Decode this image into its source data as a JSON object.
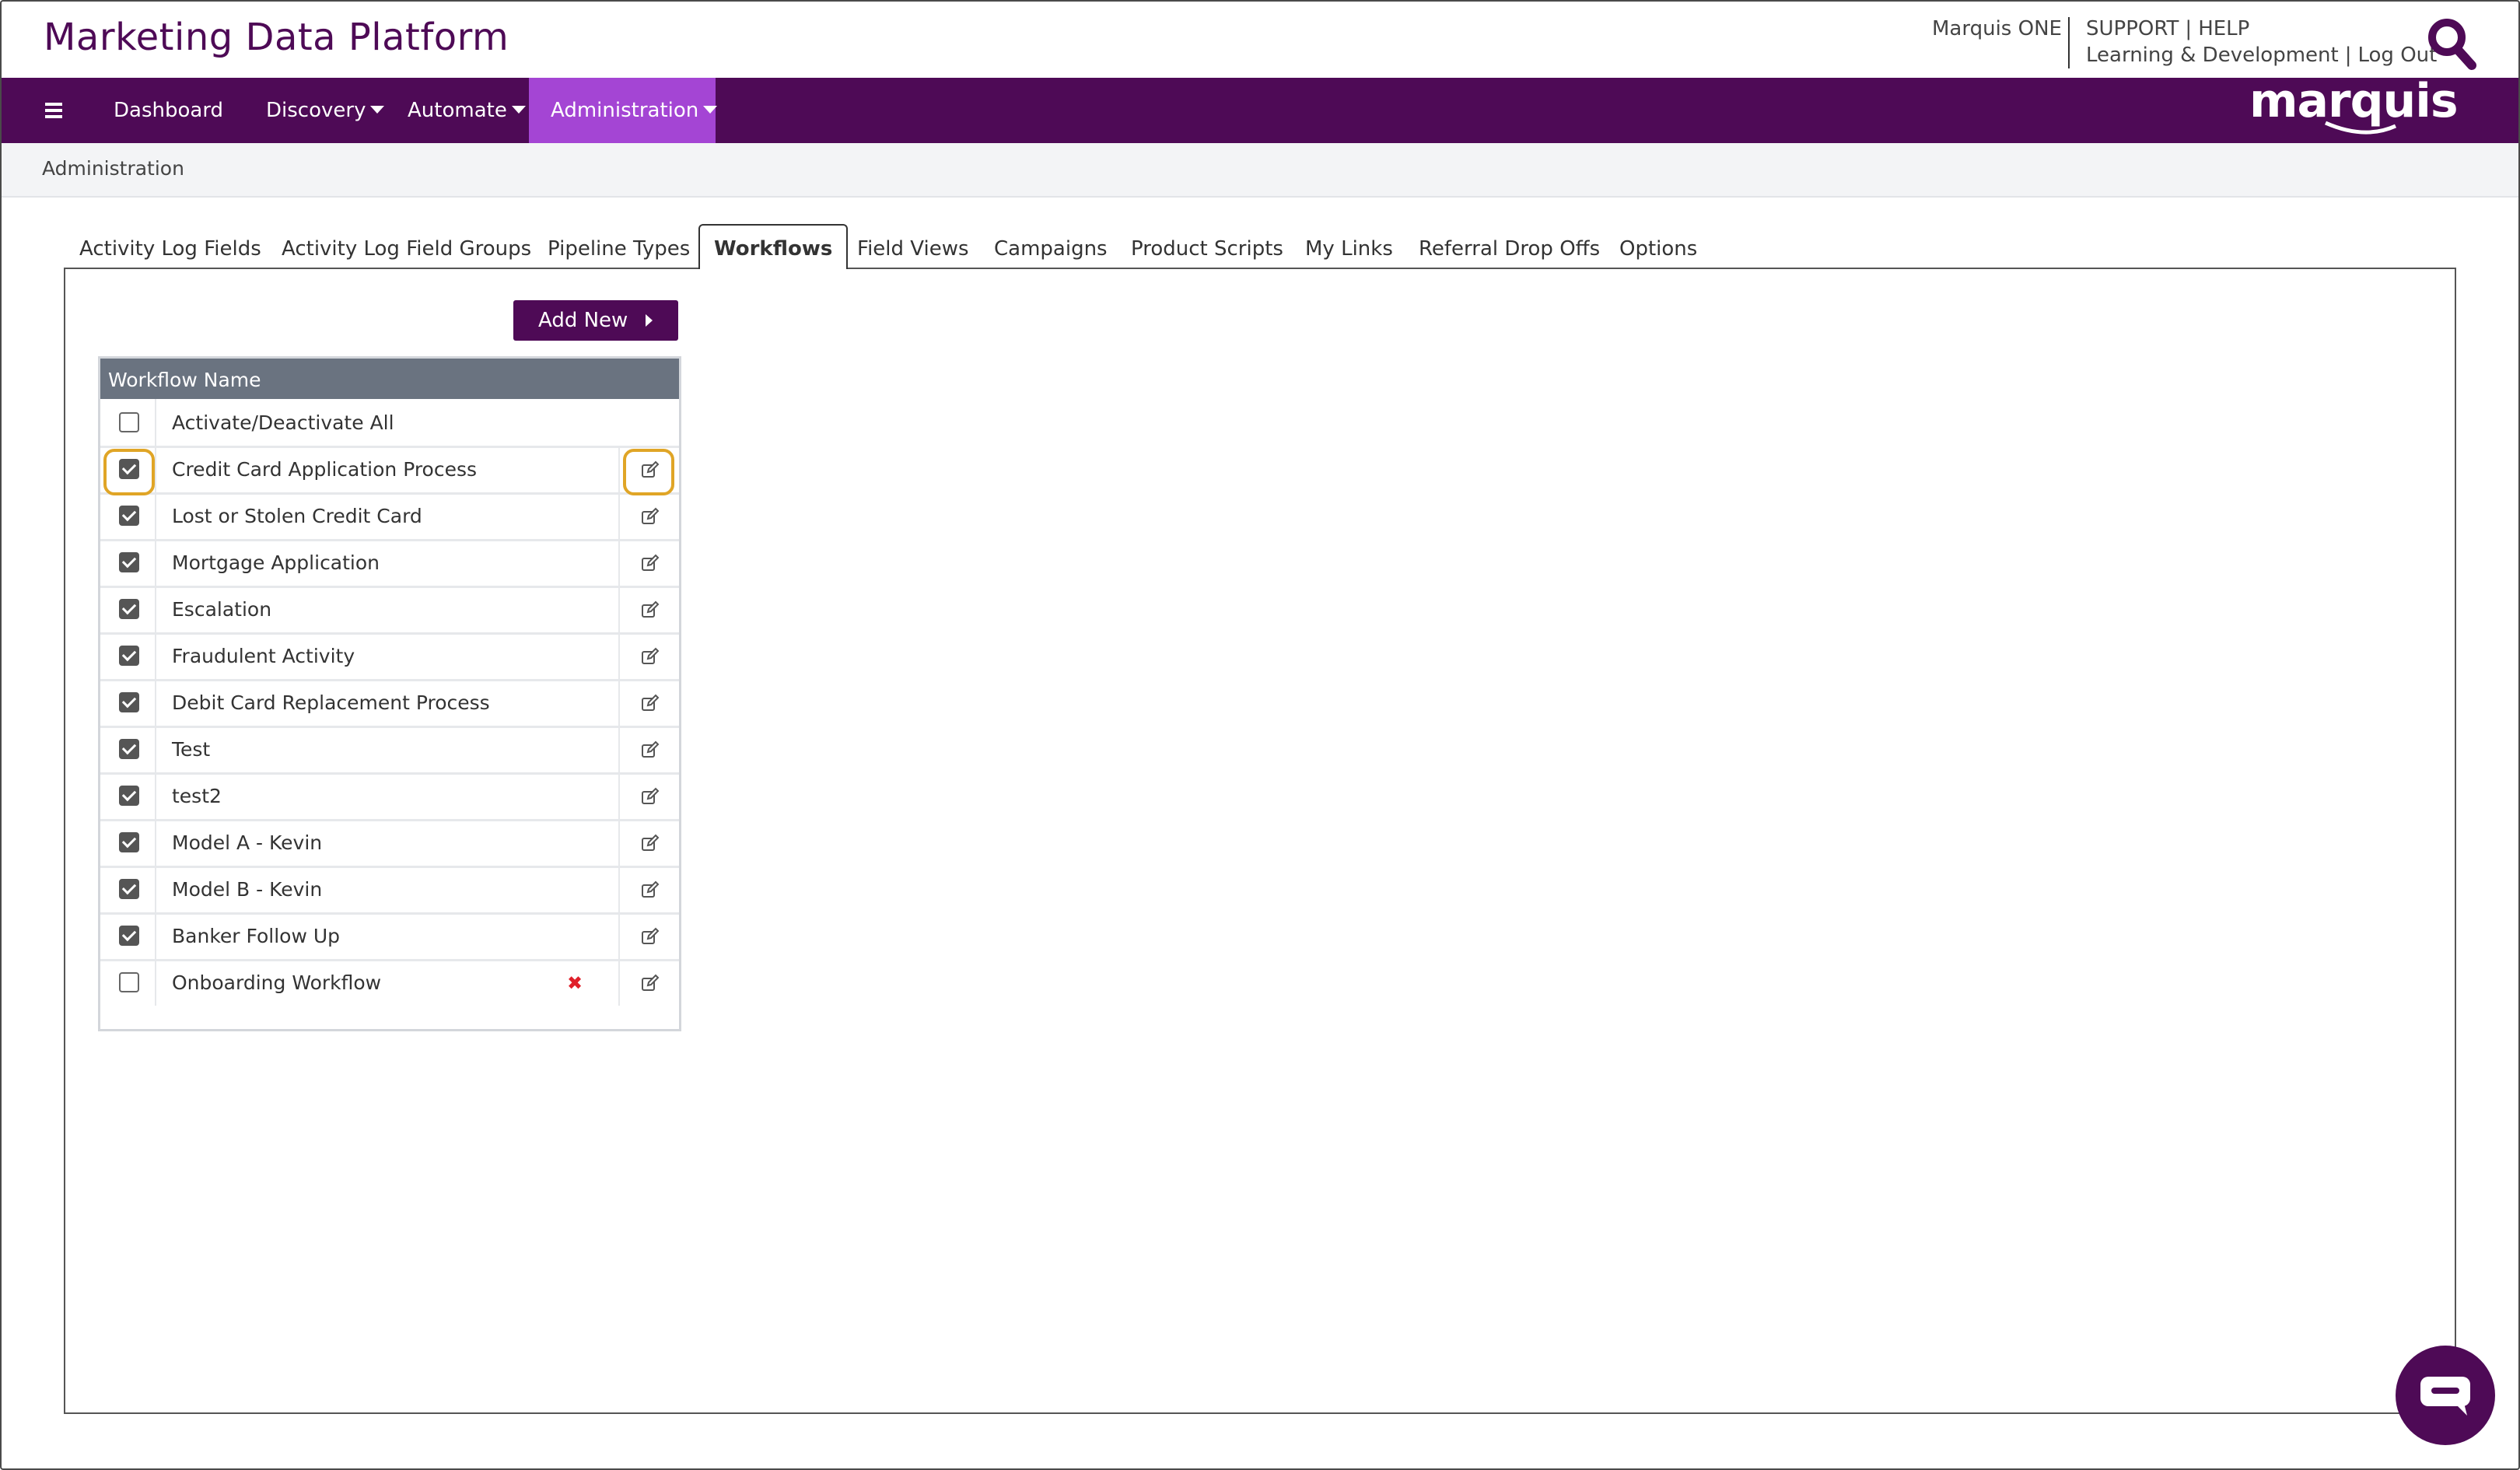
{
  "header": {
    "app_title": "Marketing Data Platform",
    "marquis_one": "Marquis ONE",
    "support": "SUPPORT",
    "help": "HELP",
    "learning": "Learning & Development",
    "logout": "Log Out",
    "search_icon": "search-icon"
  },
  "nav": {
    "menu_icon": "hamburger-menu-icon",
    "items": [
      "Dashboard",
      "Discovery",
      "Automate",
      "Administration"
    ],
    "active": "Administration",
    "logo_text": "marquis",
    "colors": {
      "bar": "#4e0a56",
      "active": "#a445d4"
    }
  },
  "breadcrumb": "Administration",
  "tabs": {
    "items": [
      "Activity Log Fields",
      "Activity Log Field Groups",
      "Pipeline Types",
      "Workflows",
      "Field Views",
      "Campaigns",
      "Product Scripts",
      "My Links",
      "Referral Drop Offs",
      "Options"
    ],
    "active": "Workflows"
  },
  "add_new_label": "Add New",
  "table": {
    "header": "Workflow Name",
    "select_all": {
      "label": "Activate/Deactivate All",
      "checked": false
    },
    "rows": [
      {
        "name": "Credit Card Application Process",
        "checked": true,
        "deletable": false,
        "highlighted": true
      },
      {
        "name": "Lost or Stolen Credit Card",
        "checked": true,
        "deletable": false
      },
      {
        "name": "Mortgage Application",
        "checked": true,
        "deletable": false
      },
      {
        "name": "Escalation",
        "checked": true,
        "deletable": false
      },
      {
        "name": "Fraudulent Activity",
        "checked": true,
        "deletable": false
      },
      {
        "name": "Debit Card Replacement Process",
        "checked": true,
        "deletable": false
      },
      {
        "name": "Test",
        "checked": true,
        "deletable": false
      },
      {
        "name": "test2",
        "checked": true,
        "deletable": false
      },
      {
        "name": "Model A - Kevin",
        "checked": true,
        "deletable": false
      },
      {
        "name": "Model B - Kevin",
        "checked": true,
        "deletable": false
      },
      {
        "name": "Banker Follow Up",
        "checked": true,
        "deletable": false
      },
      {
        "name": "Onboarding Workflow",
        "checked": false,
        "deletable": true
      }
    ],
    "edit_icon": "edit-icon",
    "delete_icon": "delete-x-icon",
    "highlight_color": "#e0a526"
  },
  "chat_icon": "chat-bubble-icon"
}
